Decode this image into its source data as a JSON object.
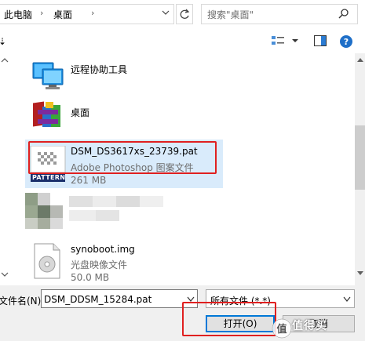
{
  "address_bar": {
    "segments": [
      "此电脑",
      "桌面"
    ],
    "search_placeholder": "搜索\"桌面\""
  },
  "toolbar": {
    "icons": [
      "view-options-icon",
      "chevron-down-icon",
      "preview-pane-icon",
      "help-icon"
    ]
  },
  "file_list": {
    "items": [
      {
        "name": "远程协助工具",
        "icon": "remote-desktop-icon"
      },
      {
        "name": "桌面",
        "icon": "winrar-icon"
      },
      {
        "name": "DSM_DS3617xs_23739.pat",
        "type": "Adobe Photoshop 图案文件",
        "size": "261 MB",
        "icon": "pattern-file-icon",
        "badge": "PATTERN",
        "selected": true
      },
      {
        "name": "synoboot.img",
        "type": "光盘映像文件",
        "size": "50.0 MB",
        "icon": "disc-image-icon"
      }
    ]
  },
  "bottom": {
    "filename_label": "文件名(N):",
    "filename_value": "DSM_DDSM_15284.pat",
    "filetype_value": "所有文件 (*.*)",
    "open_label": "打开(O)",
    "cancel_label": "取消",
    "watermark": "值得买"
  },
  "colors": {
    "selection": "#d9ebfb",
    "highlight_box": "#e02020",
    "accent": "#0078d7"
  }
}
